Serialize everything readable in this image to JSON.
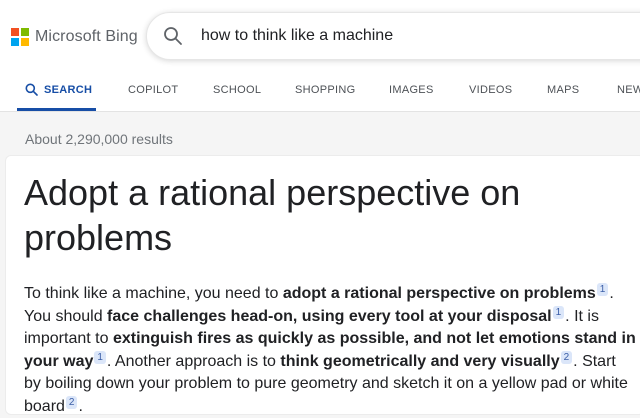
{
  "brand": {
    "name": "Microsoft Bing",
    "logo_colors": [
      "#f25022",
      "#7fba00",
      "#00a4ef",
      "#ffb900"
    ]
  },
  "search": {
    "query": "how to think like a machine",
    "icon": "search-icon"
  },
  "tabs": [
    {
      "label": "SEARCH",
      "active": true
    },
    {
      "label": "COPILOT"
    },
    {
      "label": "SCHOOL"
    },
    {
      "label": "SHOPPING"
    },
    {
      "label": "IMAGES"
    },
    {
      "label": "VIDEOS"
    },
    {
      "label": "MAPS"
    },
    {
      "label": "NEW"
    }
  ],
  "results_count": "About 2,290,000 results",
  "answer": {
    "title": "Adopt a rational perspective on problems",
    "segments": [
      {
        "text": "To think like a machine, you need to "
      },
      {
        "text": "adopt a rational perspective on problems",
        "bold": true
      },
      {
        "cite": "1"
      },
      {
        "text": ". You should "
      },
      {
        "text": "face challenges head-on, using every tool at your disposal",
        "bold": true
      },
      {
        "cite": "1"
      },
      {
        "text": ". It is important to "
      },
      {
        "text": "extinguish fires as quickly as possible, and not let emotions stand in your way",
        "bold": true
      },
      {
        "cite": "1"
      },
      {
        "text": ". Another approach is to "
      },
      {
        "text": "think geometrically and very visually",
        "bold": true
      },
      {
        "cite": "2"
      },
      {
        "text": ". Start by boiling down your problem to pure geometry and sketch it on a yellow pad or white board"
      },
      {
        "cite": "2"
      },
      {
        "text": "."
      }
    ]
  },
  "colors": {
    "accent": "#174ea6",
    "citation_bg": "#dbe6f9"
  }
}
